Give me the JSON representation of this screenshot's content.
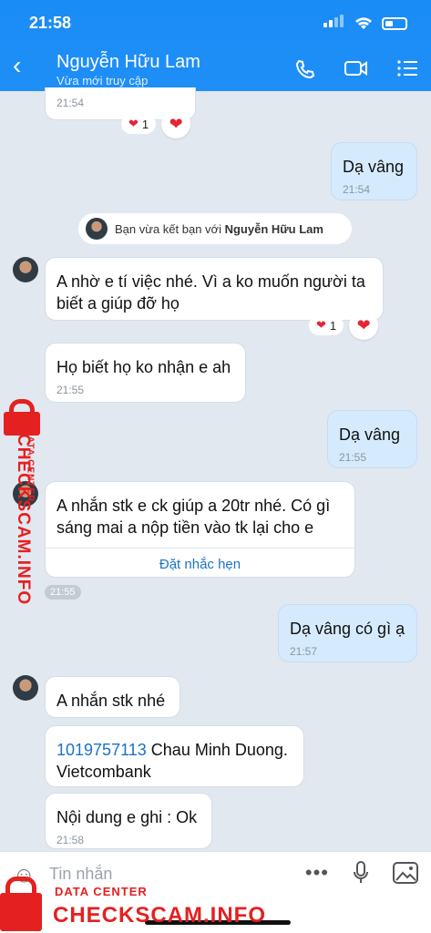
{
  "status": {
    "time": "21:58"
  },
  "header": {
    "name": "Nguyễn Hữu Lam",
    "status": "Vừa mới truy cập"
  },
  "messages": {
    "m0": {
      "time": "21:54",
      "reaction_count": "1"
    },
    "m1": {
      "text": "Dạ vâng",
      "time": "21:54"
    },
    "system": {
      "prefix": "Bạn vừa kết bạn với",
      "name": "Nguyễn Hữu Lam"
    },
    "m2": {
      "text": "A nhờ e tí việc nhé. Vì a ko muốn người ta biết a giúp đỡ họ",
      "reaction_count": "1"
    },
    "m3": {
      "text": "Họ biết họ ko nhận e ah",
      "time": "21:55"
    },
    "m4": {
      "text": "Dạ vâng",
      "time": "21:55"
    },
    "m5": {
      "text": "A nhắn stk e ck giúp a 20tr nhé. Có gì sáng mai a nộp tiền vào tk lại cho e",
      "action": "Đặt nhắc hẹn",
      "time": "21:55"
    },
    "m6": {
      "text": "Dạ vâng có gì ạ",
      "time": "21:57"
    },
    "m7": {
      "text": "A nhắn stk nhé"
    },
    "m8": {
      "account": "1019757113",
      "text_rest": "Chau Minh Duong. Vietcombank"
    },
    "m9": {
      "text": "Nội dung e ghi : Ok",
      "time": "21:58"
    }
  },
  "composer": {
    "placeholder": "Tin nhắn"
  },
  "watermark": {
    "data_center": "DATA CENTER",
    "brand": "CHECKSCAM.INFO"
  },
  "colors": {
    "header": "#1f8ff7",
    "mine_bubble": "#d5ebfd",
    "watermark": "#e52020"
  }
}
